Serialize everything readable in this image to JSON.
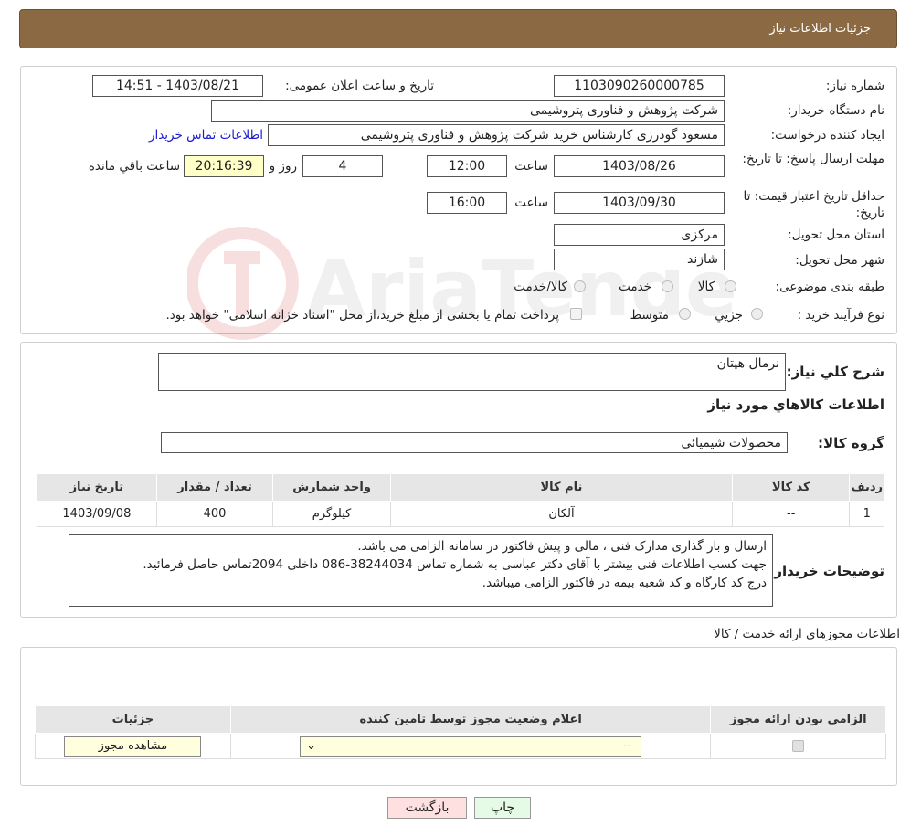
{
  "header": {
    "title": "جزئیات اطلاعات نیاز"
  },
  "need": {
    "number_label": "شماره نیاز:",
    "number": "1103090260000785",
    "announce_label": "تاریخ و ساعت اعلان عمومی:",
    "announce_value": "1403/08/21 - 14:51",
    "buyer_label": "نام دستگاه خریدار:",
    "buyer": "شرکت پژوهش و فناوری پتروشیمی",
    "creator_label": "ایجاد کننده درخواست:",
    "creator": "مسعود گودرزی کارشناس خرید شرکت پژوهش و فناوری پتروشیمی",
    "contact_link": "اطلاعات تماس خریدار",
    "deadline_label": "مهلت ارسال پاسخ: تا تاریخ:",
    "deadline_date": "1403/08/26",
    "time_word": "ساعت",
    "deadline_time": "12:00",
    "days": "4",
    "days_word": "روز و",
    "remaining": "20:16:39",
    "remaining_word": "ساعت باقي مانده",
    "validity_label": "حداقل تاریخ اعتبار قیمت: تا تاریخ:",
    "validity_date": "1403/09/30",
    "validity_time": "16:00",
    "province_label": "استان محل تحویل:",
    "province": "مرکزی",
    "city_label": "شهر محل تحویل:",
    "city": "شازند",
    "category_label": "طبقه بندی موضوعی:",
    "cat_goods": "کالا",
    "cat_service": "خدمت",
    "cat_both": "کالا/خدمت",
    "process_label": "نوع فرآیند خرید :",
    "proc_minor": "جزیي",
    "proc_medium": "متوسط",
    "payment_note": "پرداخت تمام یا بخشی از مبلغ خرید،از محل \"اسناد خزانه اسلامی\" خواهد بود."
  },
  "details": {
    "summary_label": "شرح کلي نیاز:",
    "summary": "نرمال هپتان",
    "goods_title": "اطلاعات کالاهاي مورد نياز",
    "group_label": "گروه کالا:",
    "group": "محصولات شیمیائی",
    "columns": [
      "رديف",
      "کد کالا",
      "نام کالا",
      "واحد شمارش",
      "تعداد / مقدار",
      "تاریخ نیاز"
    ],
    "rows": [
      [
        "1",
        "--",
        "آلکان",
        "کیلوگرم",
        "400",
        "1403/09/08"
      ]
    ],
    "notes_label": "توضیحات خریدار:",
    "notes_line1": "ارسال و بار گذاری مدارک فنی ، مالی و پیش فاکتور در سامانه الزامی می باشد.",
    "notes_line2": "جهت کسب اطلاعات فنی بیشتر با آقای دکتر عباسی به شماره تماس 38244034-086 داخلی 2094تماس حاصل فرمائید.",
    "notes_line3": "درج کد کارگاه و کد شعبه بیمه  در فاکتور الزامی میباشد."
  },
  "permits": {
    "title": "اطلاعات مجوزهای ارائه خدمت / کالا",
    "columns": [
      "الزامی بودن ارائه مجوز",
      "اعلام وضعیت مجوز توسط تامین کننده",
      "جزئیات"
    ],
    "select_value": "--",
    "view_button": "مشاهده مجوز"
  },
  "buttons": {
    "print": "چاپ",
    "back": "بازگشت"
  },
  "watermark": "AriaTender.neT"
}
